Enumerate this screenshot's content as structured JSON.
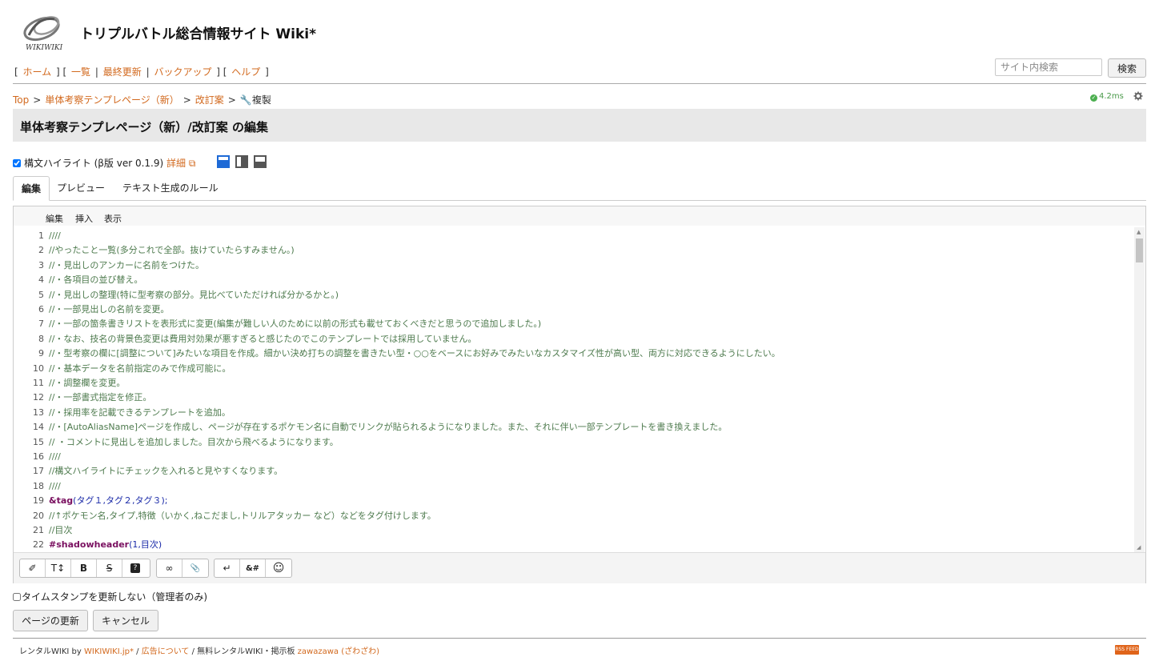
{
  "header": {
    "logo_text": "WIKIWIKI",
    "site_title": "トリプルバトル総合情報サイト Wiki*"
  },
  "nav": {
    "home": "ホーム",
    "list": "一覧",
    "recent": "最終更新",
    "backup": "バックアップ",
    "help": "ヘルプ"
  },
  "search": {
    "placeholder": "サイト内検索",
    "button_label": "検索"
  },
  "breadcrumb": {
    "top": "Top",
    "parent": "単体考察テンプレページ（新）",
    "page": "改訂案",
    "current": "複製"
  },
  "timing": "4.2ms",
  "page_title": "単体考察テンプレページ（新）/改訂案 の編集",
  "syntax": {
    "label": "構文ハイライト (β版 ver 0.1.9)",
    "details_link": "詳細",
    "checked": true
  },
  "tabs": [
    {
      "label": "編集",
      "active": true
    },
    {
      "label": "プレビュー",
      "active": false
    },
    {
      "label": "テキスト生成のルール",
      "active": false
    }
  ],
  "editor_menu": [
    "編集",
    "挿入",
    "表示"
  ],
  "code_lines": [
    {
      "n": "1",
      "text": "////"
    },
    {
      "n": "2",
      "text": "//やったこと一覧(多分これで全部。抜けていたらすみません。)"
    },
    {
      "n": "3",
      "text": "//・見出しのアンカーに名前をつけた。"
    },
    {
      "n": "4",
      "text": "//・各項目の並び替え。"
    },
    {
      "n": "5",
      "text": "//・見出しの整理(特に型考察の部分。見比べていただければ分かるかと。)"
    },
    {
      "n": "6",
      "text": "//・一部見出しの名前を変更。"
    },
    {
      "n": "7",
      "text": "//・一部の箇条書きリストを表形式に変更(編集が難しい人のために以前の形式も載せておくべきだと思うので追加しました。)"
    },
    {
      "n": "8",
      "text": "//・なお、技名の背景色変更は費用対効果が悪すぎると感じたのでこのテンプレートでは採用していません。"
    },
    {
      "n": "9",
      "text": "//・型考察の欄に[調整について]みたいな項目を作成。細かい決め打ちの調整を書きたい型・○○をベースにお好みでみたいなカスタマイズ性が高い型、両方に対応できるようにしたい。"
    },
    {
      "n": "10",
      "text": "//・基本データを名前指定のみで作成可能に。"
    },
    {
      "n": "11",
      "text": "//・調整欄を変更。"
    },
    {
      "n": "12",
      "text": "//・一部書式指定を修正。"
    },
    {
      "n": "13",
      "text": "//・採用率を記載できるテンプレートを追加。"
    },
    {
      "n": "14",
      "text": "//・[AutoAliasName]ページを作成し、ページが存在するポケモン名に自動でリンクが貼られるようになりました。また、それに伴い一部テンプレートを書き換えました。"
    },
    {
      "n": "15",
      "text": "// ・コメントに見出しを追加しました。目次から飛べるようになります。"
    },
    {
      "n": "16",
      "text": "////"
    },
    {
      "n": "17",
      "text": "//構文ハイライトにチェックを入れると見やすくなります。"
    },
    {
      "n": "18",
      "text": "////"
    },
    {
      "n": "19",
      "plugin": "&tag",
      "args": "(タグ１,タグ２,タグ３);"
    },
    {
      "n": "20",
      "text": "//↑ポケモン名,タイプ,特徴（いかく,ねこだまし,トリルアタッカー など）などをタグ付けします。"
    },
    {
      "n": "21",
      "text": "//目次"
    },
    {
      "n": "22",
      "plugin": "#shadowheader",
      "args": "(1,目次)"
    }
  ],
  "toolbar": {
    "group1": [
      "✐",
      "T↕",
      "B",
      "S",
      "?"
    ],
    "group2": [
      "∞",
      "📎"
    ],
    "group3": [
      "↵",
      "&#",
      "☺"
    ]
  },
  "timestamp": {
    "label": "タイムスタンプを更新しない（管理者のみ)",
    "checked": false
  },
  "actions": {
    "update": "ページの更新",
    "cancel": "キャンセル"
  },
  "footer": {
    "prefix": "レンタルWIKI by",
    "wikiwiki": "WIKIWIKI.jp*",
    "sep1": " / ",
    "ads": "広告について",
    "sep2": " / 無料レンタルWIKI・掲示板 ",
    "zawazawa": "zawazawa (ざわざわ)",
    "badge": "RSS FEED"
  },
  "colors": {
    "link": "#d2691e",
    "comment": "#4d7a4d",
    "plugin": "#7a1060",
    "args": "#1a2aa8",
    "title_bar": "#e8e8e8"
  }
}
